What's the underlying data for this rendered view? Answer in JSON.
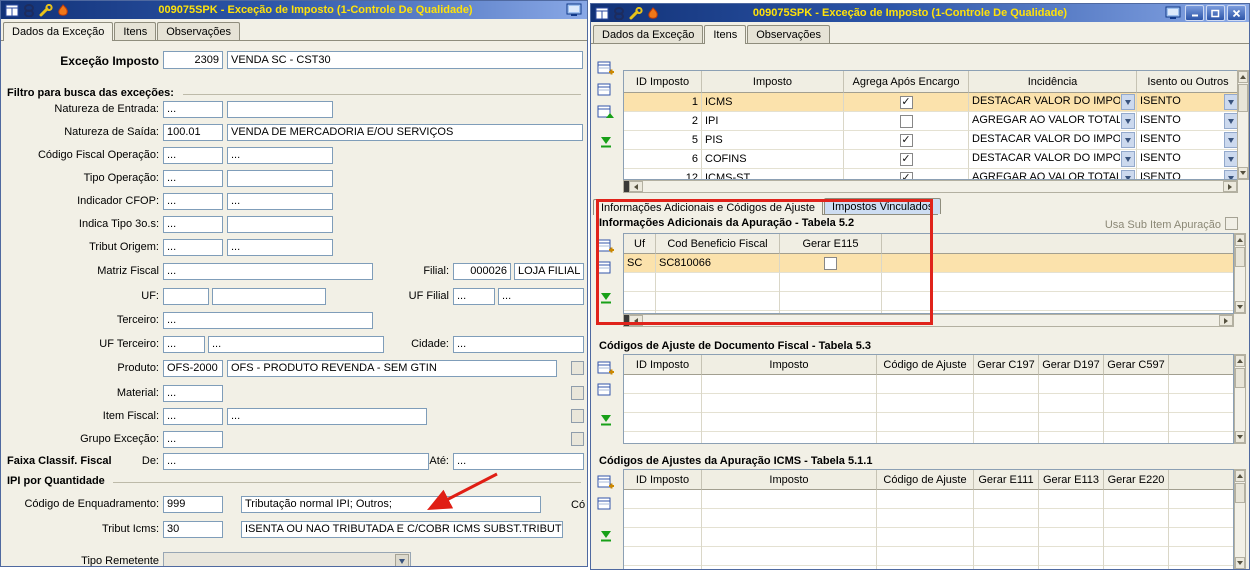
{
  "left_window": {
    "title": "009075SPK - Exceção de Imposto (1-Controle De Qualidade)",
    "tabs": {
      "dados": "Dados da Exceção",
      "itens": "Itens",
      "observacoes": "Observações"
    },
    "excecao": {
      "label": "Exceção Imposto",
      "code": "2309",
      "desc": "VENDA SC - CST30"
    },
    "filter_section": "Filtro para busca das exceções:",
    "natureza_entrada": {
      "label": "Natureza de Entrada:",
      "code": "...",
      "desc": ""
    },
    "natureza_saida": {
      "label": "Natureza de Saída:",
      "code": "100.01",
      "desc": "VENDA DE MERCADORIA E/OU SERVIÇOS"
    },
    "codigo_fiscal_operacao": {
      "label": "Código Fiscal Operação:",
      "code": "...",
      "desc": "..."
    },
    "tipo_operacao": {
      "label": "Tipo Operação:",
      "code": "...",
      "desc": ""
    },
    "indicador_cfop": {
      "label": "Indicador CFOP:",
      "code": "...",
      "desc": "..."
    },
    "indica_tipo_3os": {
      "label": "Indica Tipo 3o.s:",
      "code": "...",
      "desc": ""
    },
    "tribut_origem": {
      "label": "Tribut Origem:",
      "code": "...",
      "desc": "..."
    },
    "matriz_fiscal": {
      "label": "Matriz Fiscal",
      "value": "..."
    },
    "filial": {
      "label": "Filial:",
      "code": "000026",
      "desc": "LOJA FILIAL S"
    },
    "uf": {
      "label": "UF:",
      "code": "",
      "desc": ""
    },
    "uf_filial": {
      "label": "UF Filial",
      "code": "...",
      "desc": "..."
    },
    "terceiro": {
      "label": "Terceiro:",
      "value": "..."
    },
    "uf_terceiro": {
      "label": "UF Terceiro:",
      "code": "...",
      "desc": "..."
    },
    "cidade": {
      "label": "Cidade:",
      "value": "..."
    },
    "produto": {
      "label": "Produto:",
      "code": "OFS-2000",
      "desc": "OFS - PRODUTO REVENDA - SEM GTIN"
    },
    "material": {
      "label": "Material:",
      "code": "..."
    },
    "item_fiscal": {
      "label": "Item Fiscal:",
      "code": "...",
      "desc": "..."
    },
    "grupo_excecao": {
      "label": "Grupo Exceção:",
      "code": "..."
    },
    "faixa": {
      "label": "Faixa Classif. Fiscal",
      "de_label": "De:",
      "de": "...",
      "ate_label": "Até:",
      "ate": "..."
    },
    "ipi_section": "IPI por Quantidade",
    "cod_enquadramento": {
      "label": "Código de Enquadramento:",
      "code": "999",
      "desc": "Tributação normal IPI; Outros;"
    },
    "cut_label": "Có",
    "tribut_icms": {
      "label": "Tribut Icms:",
      "code": "30",
      "desc": "ISENTA OU NAO TRIBUTADA E C/COBR ICMS SUBST.TRIBUT"
    },
    "tipo_remetente": {
      "label": "Tipo Remetente"
    }
  },
  "right_window": {
    "title": "009075SPK - Exceção de Imposto (1-Controle De Qualidade)",
    "tabs": {
      "dados": "Dados da Exceção",
      "itens": "Itens",
      "observacoes": "Observações"
    },
    "grid_impostos": {
      "columns": [
        "ID Imposto",
        "Imposto",
        "Agrega Após Encargo",
        "Incidência",
        "Isento ou Outros"
      ],
      "rows": [
        {
          "id": "1",
          "imposto": "ICMS",
          "agrega": true,
          "incidencia": "DESTACAR VALOR DO IMPOST",
          "isento": "ISENTO"
        },
        {
          "id": "2",
          "imposto": "IPI",
          "agrega": false,
          "incidencia": "AGREGAR AO VALOR TOTAL D",
          "isento": "ISENTO"
        },
        {
          "id": "5",
          "imposto": "PIS",
          "agrega": true,
          "incidencia": "DESTACAR VALOR DO IMPOST",
          "isento": "ISENTO"
        },
        {
          "id": "6",
          "imposto": "COFINS",
          "agrega": true,
          "incidencia": "DESTACAR VALOR DO IMPOST",
          "isento": "ISENTO"
        },
        {
          "id": "12",
          "imposto": "ICMS-ST",
          "agrega": true,
          "incidencia": "AGREGAR AO VALOR TOTAL D",
          "isento": "ISENTO"
        }
      ]
    },
    "sub_tabs": {
      "info": "Informações Adicionais e Códigos de Ajuste",
      "vinculados": "Impostos Vinculados"
    },
    "apuracao": {
      "title": "Informações Adicionais da Apuração - Tabela 5.2",
      "usa_sub_item": "Usa Sub Item Apuração",
      "columns": [
        "Uf",
        "Cod Beneficio Fiscal",
        "Gerar E115"
      ],
      "rows": [
        {
          "uf": "SC",
          "cod_beneficio": "SC810066",
          "gerar_e115": false
        }
      ]
    },
    "doc_fiscal": {
      "title": "Códigos de Ajuste de Documento Fiscal - Tabela 5.3",
      "columns": [
        "ID Imposto",
        "Imposto",
        "Código de Ajuste",
        "Gerar C197",
        "Gerar D197",
        "Gerar C597"
      ]
    },
    "apuracao_icms": {
      "title": "Códigos de Ajustes da Apuração ICMS - Tabela 5.1.1",
      "columns": [
        "ID Imposto",
        "Imposto",
        "Código de Ajuste",
        "Gerar E111",
        "Gerar E113",
        "Gerar E220"
      ]
    }
  }
}
